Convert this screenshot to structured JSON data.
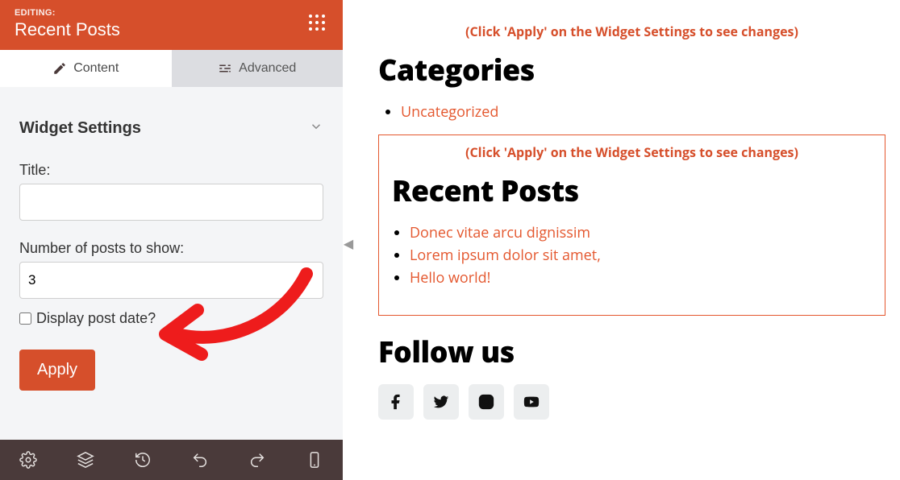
{
  "header": {
    "editing_label": "EDITING:",
    "title": "Recent Posts"
  },
  "tabs": {
    "content": "Content",
    "advanced": "Advanced"
  },
  "widget_settings": {
    "section_title": "Widget Settings",
    "title_label": "Title:",
    "title_value": "",
    "count_label": "Number of posts to show:",
    "count_value": "3",
    "display_date_label": "Display post date?",
    "display_date_checked": false,
    "apply_label": "Apply"
  },
  "preview": {
    "hint": "(Click 'Apply' on the Widget Settings to see changes)",
    "categories_heading": "Categories",
    "categories": [
      "Uncategorized"
    ],
    "recent_heading": "Recent Posts",
    "recent_posts": [
      "Donec vitae arcu dignissim",
      "Lorem ipsum dolor sit amet,",
      "Hello world!"
    ],
    "follow_heading": "Follow us",
    "social": [
      "facebook",
      "twitter",
      "instagram",
      "youtube"
    ]
  }
}
